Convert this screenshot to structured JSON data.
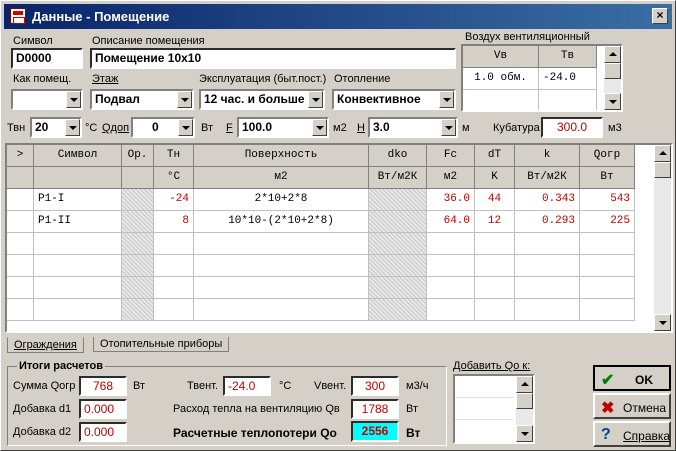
{
  "window": {
    "title": "Данные - Помещение",
    "close_label": "×"
  },
  "header": {
    "symbol_label": "Символ",
    "symbol_value": "D0000",
    "description_label": "Описание помещения",
    "description_value": "Помещение 10х10",
    "room_type_label": "Как помещ.",
    "room_type_value": "",
    "floor_label": "Этаж",
    "floor_value": "Подвал",
    "exploitation_label": "Эксплуатация (быт.пост.)",
    "exploitation_value": "12 час. и больше",
    "heating_label": "Отопление",
    "heating_value": "Конвективное"
  },
  "ventilation": {
    "title": "Воздух вентиляционный",
    "col_vv": "Vв",
    "col_tv": "Тв",
    "vv_value": "1.0 обм.",
    "tv_value": "-24.0"
  },
  "params": {
    "tvn_label": "Твн",
    "tvn_value": "20",
    "tvn_unit": "°С",
    "qdop_label": "Qдоп",
    "qdop_value": "0",
    "qdop_unit": "Вт",
    "f_label": "F",
    "f_value": "100.0",
    "f_unit": "м2",
    "h_label": "H",
    "h_value": "3.0",
    "h_unit": "м",
    "volume_label": "Кубатура",
    "volume_value": "300.0",
    "volume_unit": "м3"
  },
  "table": {
    "columns": [
      "&gt;",
      "Символ",
      "Ор.",
      "Тн",
      "Поверхность",
      "dko",
      "Fc",
      "dT",
      "k",
      "Qогр"
    ],
    "units": [
      "",
      "",
      "",
      "°С",
      "м2",
      "Вт/м2К",
      "м2",
      "K",
      "Вт/м2К",
      "Вт"
    ],
    "rows": [
      {
        "symbol": "P1-I",
        "tn": "-24",
        "surface": "2*10+2*8",
        "fc": "36.0",
        "dt": "44",
        "k": "0.343",
        "q": "543"
      },
      {
        "symbol": "P1-II",
        "tn": "8",
        "surface": "10*10-(2*10+2*8)",
        "fc": "64.0",
        "dt": "12",
        "k": "0.293",
        "q": "225"
      }
    ]
  },
  "tabs": {
    "tab1": "Ограждения",
    "tab2": "Отопительные приборы"
  },
  "results": {
    "title": "Итоги расчетов",
    "sum_q_label": "Сумма Qогр",
    "sum_q_value": "768",
    "sum_q_unit": "Вт",
    "d1_label": "Добавка d1",
    "d1_value": "0.000",
    "d2_label": "Добавка d2",
    "d2_value": "0.000",
    "tvent_label": "Твент.",
    "tvent_value": "-24.0",
    "tvent_unit": "°С",
    "vvent_label": "Vвент.",
    "vvent_value": "300",
    "vvent_unit": "м3/ч",
    "qv_label": "Расход тепла на вентиляцию Qв",
    "qv_value": "1788",
    "qv_unit": "Вт",
    "qo_label": "Расчетные теплопотери Qо",
    "qo_value": "2556",
    "qo_unit": "Вт"
  },
  "add_q": {
    "label": "Добавить Qо к:"
  },
  "buttons": {
    "ok": "OK",
    "cancel": "Отмена",
    "help": "Справка"
  }
}
